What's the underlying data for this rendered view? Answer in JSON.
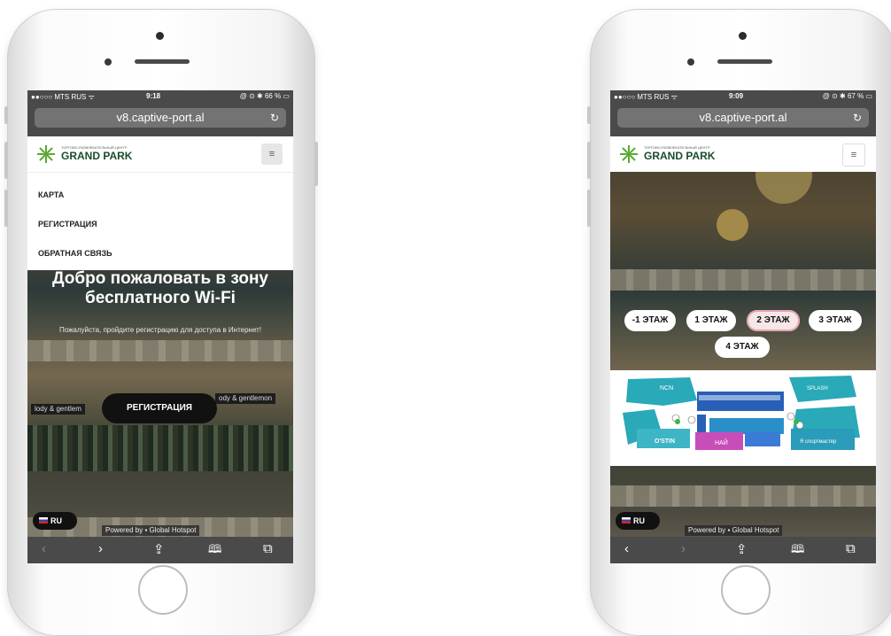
{
  "left_phone": {
    "status": {
      "carrier": "●●○○○ MTS RUS ᯤ",
      "time": "9:18",
      "battery": "@ ⊙ ✱ 66 % ▭"
    },
    "address": "v8.captive-port.al",
    "logo": {
      "small": "ТОРГОВО-РАЗВЛЕКАТЕЛЬНЫЙ ЦЕНТР",
      "name": "GRAND PARK"
    },
    "menu": [
      "КАРТА",
      "РЕГИСТРАЦИЯ",
      "ОБРАТНАЯ СВЯЗЬ"
    ],
    "welcome": "Добро пожаловать в зону бесплатного Wi-Fi",
    "welcome_sub": "Пожалуйста, пройдите регистрацию для доступа в Интернет!",
    "register_button": "РЕГИСТРАЦИЯ",
    "lang": "RU",
    "powered": "Powered by ▪ Global Hotspot",
    "signs": [
      "lody & gentlem",
      "ody & gentlemon"
    ]
  },
  "right_phone": {
    "status": {
      "carrier": "●●○○○ MTS RUS ᯤ",
      "time": "9:09",
      "battery": "@ ⊙ ✱ 67 % ▭"
    },
    "address": "v8.captive-port.al",
    "logo": {
      "small": "ТОРГОВО-РАЗВЛЕКАТЕЛЬНЫЙ ЦЕНТР",
      "name": "GRAND PARK"
    },
    "floors": [
      "-1 ЭТАЖ",
      "1 ЭТАЖ",
      "2 ЭТАЖ",
      "3 ЭТАЖ",
      "4 ЭТАЖ"
    ],
    "active_floor": "2 ЭТАЖ",
    "map_labels": [
      "NCN",
      "SPLASH",
      "O'STIN",
      "НАЙ",
      "Я спортмастер"
    ],
    "lang": "RU",
    "powered": "Powered by ▪ Global Hotspot"
  },
  "toolbar_icons": [
    "back-arrow-icon",
    "forward-arrow-icon",
    "share-icon",
    "bookmarks-icon",
    "tabs-icon"
  ],
  "toolbar_glyphs": {
    "back": "‹",
    "forward": "›",
    "share": "⇪",
    "bookmarks": "🕮",
    "tabs": "⧉",
    "reload": "↻",
    "menu": "≡"
  },
  "colors": {
    "brand_green": "#1a4d2a",
    "active_floor_border": "#e3a5b0",
    "browser_chrome": "#4a4a4a"
  }
}
